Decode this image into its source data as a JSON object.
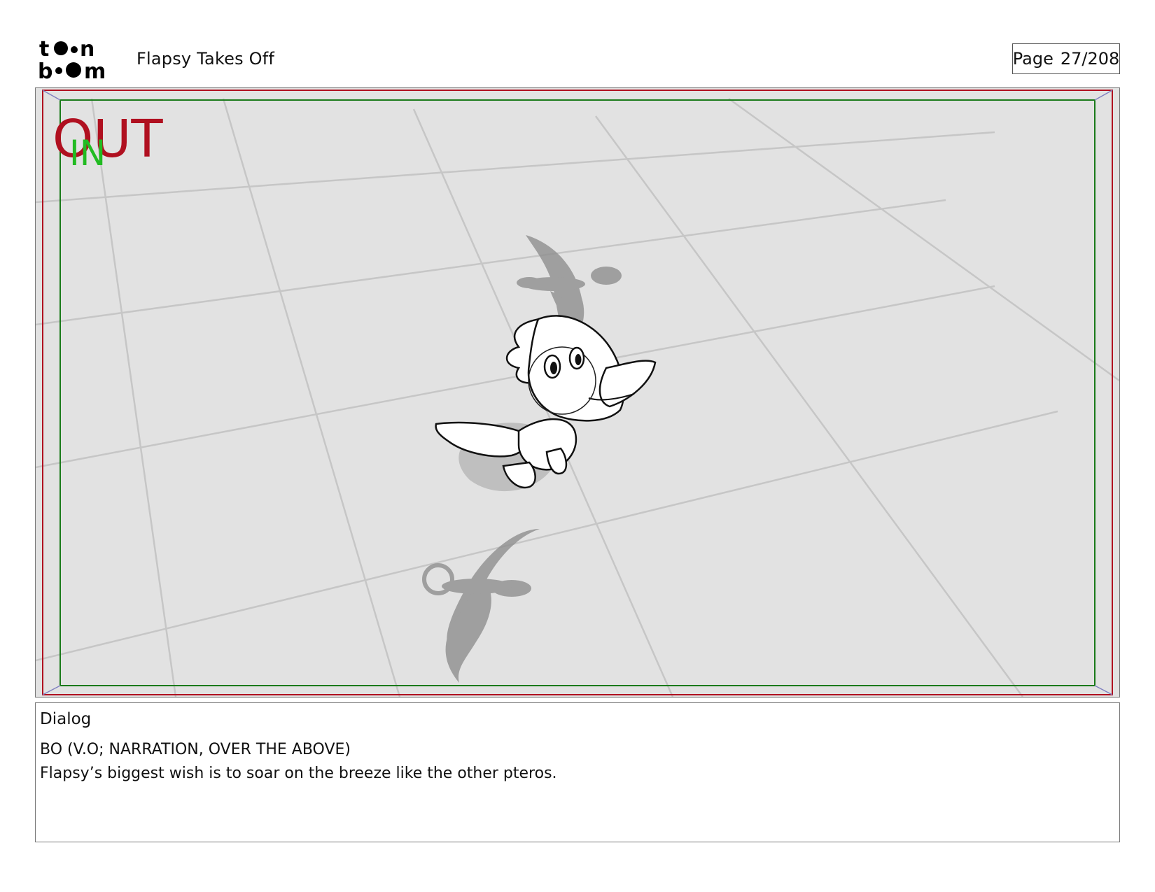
{
  "header": {
    "logo_text": "toon boom",
    "project_title": "Flapsy Takes Off",
    "page_label": "Page",
    "page_number": "27/208"
  },
  "panel": {
    "out_marker": "OUT",
    "in_marker": "IN",
    "colors": {
      "out_frame": "#b01020",
      "in_frame": "#1a7a1a",
      "in_text": "#22bb22",
      "grid": "#c4c4c4",
      "floor": "#e2e2e2"
    }
  },
  "dialog": {
    "heading": "Dialog",
    "speaker": "BO (V.O; NARRATION, OVER THE ABOVE)",
    "line": "Flapsy’s biggest wish is to soar on the breeze like the other pteros."
  }
}
